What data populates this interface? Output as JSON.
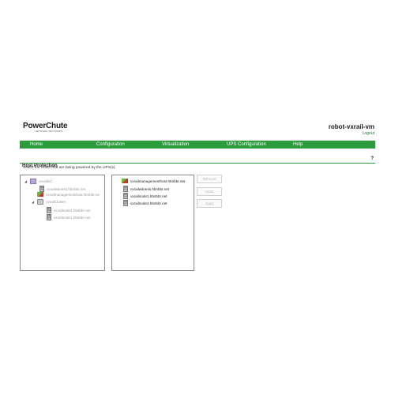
{
  "brand": {
    "name": "PowerChute",
    "tagline": "NETWORK SHUTDOWN"
  },
  "header": {
    "hostname": "robot-vxrail-vm",
    "logout": "Logout"
  },
  "nav": {
    "items": [
      "Home",
      "Configuration",
      "Virtualization",
      "UPS Configuration",
      "Help"
    ]
  },
  "section": {
    "title": "Host Protection",
    "help": "?",
    "instruction": "Select the Hosts that are being powered by the UPS(s)."
  },
  "available_tree": [
    {
      "label": "vxrailDC",
      "icon": "datacenter-icon",
      "expanded": true
    },
    {
      "label": "vxrailwitness.hbnbbr.net",
      "icon": "server-icon"
    },
    {
      "label": "vxrailmanagementhost.hbnbbr.ne",
      "icon": "vcsa-icon"
    },
    {
      "label": "vxrailCluster",
      "icon": "cluster-icon",
      "expanded": true
    },
    {
      "label": "vxrailnode2.hbnbbr.net",
      "icon": "server-icon"
    },
    {
      "label": "vxrailnode1.hbnbbr.net",
      "icon": "server-icon"
    }
  ],
  "selected_tree": [
    {
      "label": "vxrailmanagementhost.hbnbbr.net",
      "icon": "vcsa-icon"
    },
    {
      "label": "vxrailwitness.hbnbbr.net",
      "icon": "server-icon"
    },
    {
      "label": "vxrailnode1.hbnbbr.net",
      "icon": "server-icon"
    },
    {
      "label": "vxrailnode2.hbnbbr.net",
      "icon": "server-icon"
    }
  ],
  "buttons": {
    "remove": "Remove",
    "undo": "Undo",
    "apply": "Apply"
  },
  "colors": {
    "accent": "#2c9b3c",
    "disabled": "#b5b5b5"
  }
}
